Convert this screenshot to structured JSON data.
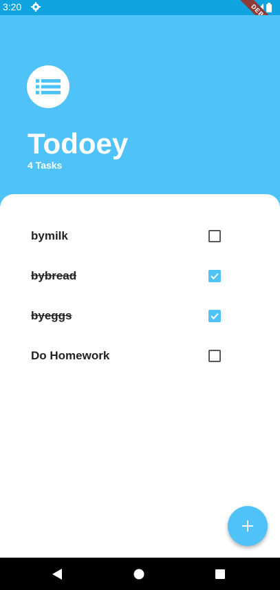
{
  "status_bar": {
    "time": "3:20"
  },
  "debug_banner": "DEBUG",
  "header": {
    "title": "Todoey",
    "task_count_label": "4 Tasks"
  },
  "tasks": [
    {
      "label": "bymilk",
      "done": false
    },
    {
      "label": "bybread",
      "done": true
    },
    {
      "label": "byeggs",
      "done": true
    },
    {
      "label": "Do Homework",
      "done": false
    }
  ],
  "colors": {
    "accent": "#4fc3f7",
    "status_bar": "#0fa4e0",
    "ribbon": "#8e3a3a"
  },
  "icons": {
    "header": "list-icon",
    "fab": "plus-icon",
    "status": "gear-icon",
    "nav": [
      "back-icon",
      "home-icon",
      "recents-icon"
    ]
  }
}
